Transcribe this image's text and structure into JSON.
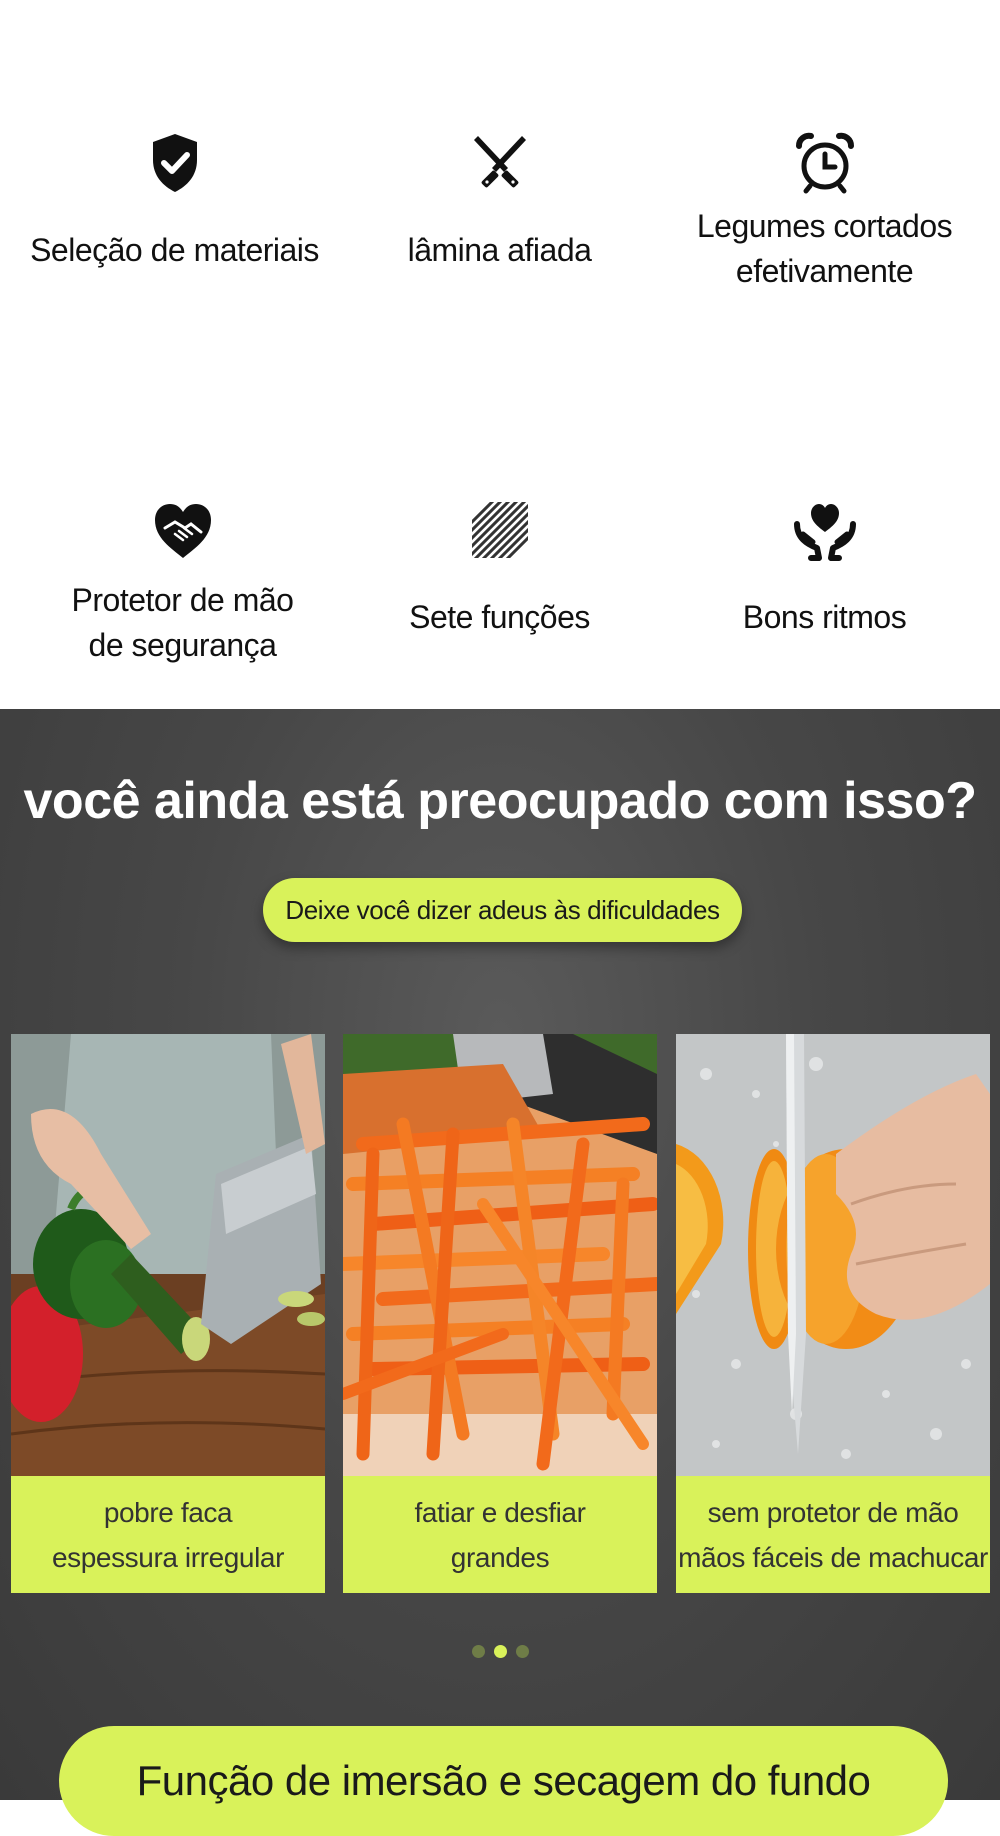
{
  "features": [
    {
      "icon": "shield-check-icon",
      "lines": [
        "Seleção de materiais"
      ]
    },
    {
      "icon": "crossed-knives-icon",
      "lines": [
        "lâmina afiada"
      ]
    },
    {
      "icon": "alarm-clock-icon",
      "lines": [
        "Legumes cortados",
        "efetivamente"
      ]
    },
    {
      "icon": "handshake-heart-icon",
      "lines": [
        "Protetor de mão",
        "de segurança"
      ]
    },
    {
      "icon": "striped-square-icon",
      "lines": [
        "Sete funções"
      ]
    },
    {
      "icon": "hands-heart-icon",
      "lines": [
        "Bons ritmos"
      ]
    }
  ],
  "section": {
    "headline": "você ainda está preocupado com isso?",
    "pill": "Deixe você dizer adeus às dificuldades"
  },
  "cards": [
    {
      "photo": "cleaver-cutting-cucumber-photo",
      "lines": [
        "pobre faca",
        "espessura irregular"
      ]
    },
    {
      "photo": "shredded-carrots-photo",
      "lines": [
        "fatiar e desfiar",
        "grandes"
      ]
    },
    {
      "photo": "knife-slicing-orange-photo",
      "lines": [
        "sem protetor de mão",
        "mãos fáceis de machucar"
      ]
    }
  ],
  "carousel": {
    "count": 3,
    "active_index": 1
  },
  "bottom_pill": "Função de imersão e secagem do fundo",
  "colors": {
    "accent": "#d9f25a",
    "dark_bg": "#474747",
    "text": "#111111",
    "dot_inactive": "#6f7d47"
  }
}
